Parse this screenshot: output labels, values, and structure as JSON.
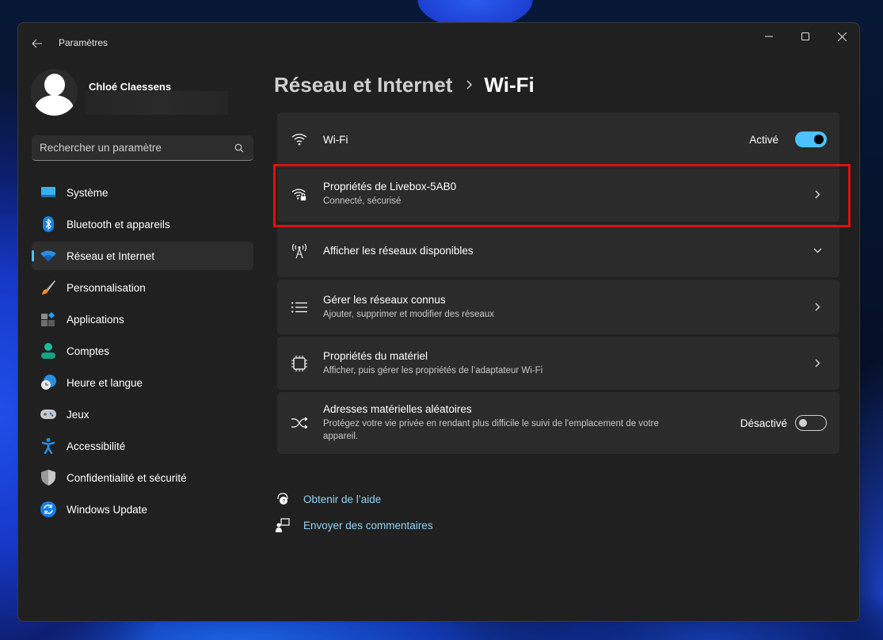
{
  "window": {
    "app_title": "Paramètres",
    "controls": {
      "minimize": "minimize",
      "maximize": "maximize",
      "close": "close"
    }
  },
  "profile": {
    "name": "Chloé Claessens"
  },
  "search": {
    "placeholder": "Rechercher un paramètre",
    "value": ""
  },
  "sidebar": {
    "items": [
      {
        "label": "Système",
        "icon": "system-icon",
        "active": false
      },
      {
        "label": "Bluetooth et appareils",
        "icon": "bluetooth-icon",
        "active": false
      },
      {
        "label": "Réseau et Internet",
        "icon": "wifi-icon",
        "active": true
      },
      {
        "label": "Personnalisation",
        "icon": "brush-icon",
        "active": false
      },
      {
        "label": "Applications",
        "icon": "apps-icon",
        "active": false
      },
      {
        "label": "Comptes",
        "icon": "account-icon",
        "active": false
      },
      {
        "label": "Heure et langue",
        "icon": "time-language-icon",
        "active": false
      },
      {
        "label": "Jeux",
        "icon": "gamepad-icon",
        "active": false
      },
      {
        "label": "Accessibilité",
        "icon": "accessibility-icon",
        "active": false
      },
      {
        "label": "Confidentialité et sécurité",
        "icon": "shield-icon",
        "active": false
      },
      {
        "label": "Windows Update",
        "icon": "update-icon",
        "active": false
      }
    ]
  },
  "breadcrumb": {
    "parent": "Réseau et Internet",
    "current": "Wi-Fi"
  },
  "cards": {
    "wifi": {
      "title": "Wi-Fi",
      "toggle_label": "Activé",
      "toggle_on": true
    },
    "network_props": {
      "title": "Propriétés de Livebox-5AB0",
      "subtitle": "Connecté, sécurisé"
    },
    "available": {
      "title": "Afficher les réseaux disponibles"
    },
    "known": {
      "title": "Gérer les réseaux connus",
      "subtitle": "Ajouter, supprimer et modifier des réseaux"
    },
    "hardware": {
      "title": "Propriétés du matériel",
      "subtitle": "Afficher, puis gérer les propriétés de l’adaptateur Wi-Fi"
    },
    "random_mac": {
      "title": "Adresses matérielles aléatoires",
      "subtitle": "Protégez votre vie privée en rendant plus difficile le suivi de l'emplacement de votre appareil.",
      "toggle_label": "Désactivé",
      "toggle_on": false
    }
  },
  "links": {
    "help": "Obtenir de l’aide",
    "feedback": "Envoyer des commentaires"
  },
  "colors": {
    "accent": "#4cc2ff",
    "highlight": "#e01010",
    "link": "#8fd3f5",
    "window_bg": "#202020",
    "card_bg": "#2b2b2b"
  }
}
